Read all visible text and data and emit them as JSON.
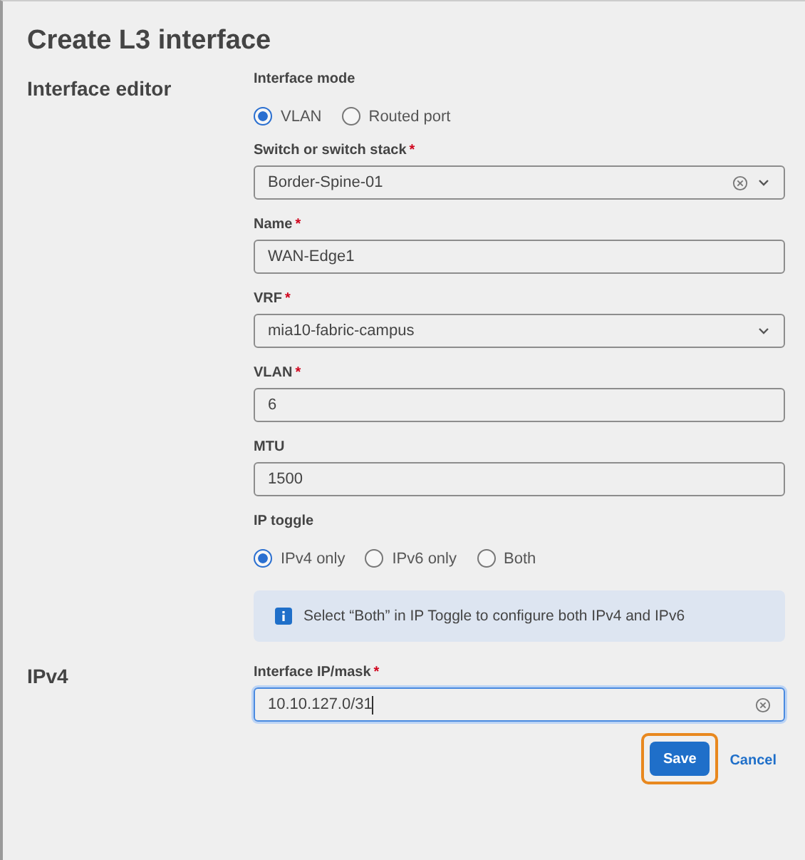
{
  "dialog": {
    "title": "Create L3 interface"
  },
  "sections": [
    {
      "heading": "Interface editor",
      "fields": [
        {
          "kind": "radio",
          "label": "Interface mode",
          "options": [
            {
              "label": "VLAN",
              "selected": true
            },
            {
              "label": "Routed port",
              "selected": false
            }
          ]
        },
        {
          "kind": "select",
          "label": "Switch or switch stack",
          "required_mark": "*",
          "value": "Border-Spine-01",
          "clearable": true
        },
        {
          "kind": "text",
          "label": "Name",
          "required_mark": "*",
          "value": "WAN-Edge1",
          "clearable": false,
          "focused": false
        },
        {
          "kind": "select",
          "label": "VRF",
          "required_mark": "*",
          "value": "mia10-fabric-campus",
          "clearable": false
        },
        {
          "kind": "text",
          "label": "VLAN",
          "required_mark": "*",
          "value": "6",
          "clearable": false,
          "focused": false
        },
        {
          "kind": "text",
          "label": "MTU",
          "value": "1500",
          "clearable": false,
          "focused": false
        },
        {
          "kind": "radio",
          "label": "IP toggle",
          "options": [
            {
              "label": "IPv4 only",
              "selected": true
            },
            {
              "label": "IPv6 only",
              "selected": false
            },
            {
              "label": "Both",
              "selected": false
            }
          ]
        },
        {
          "kind": "info",
          "text": "Select “Both” in IP Toggle to configure both IPv4 and IPv6"
        }
      ]
    },
    {
      "heading": "IPv4",
      "fields": [
        {
          "kind": "text",
          "label": "Interface IP/mask",
          "required_mark": "*",
          "value": "10.10.127.0/31",
          "clearable": true,
          "focused": true
        }
      ]
    }
  ],
  "buttons": [
    {
      "label": "Save",
      "kind": "primary",
      "highlighted": true
    },
    {
      "label": "Cancel",
      "kind": "link",
      "highlighted": false
    }
  ]
}
